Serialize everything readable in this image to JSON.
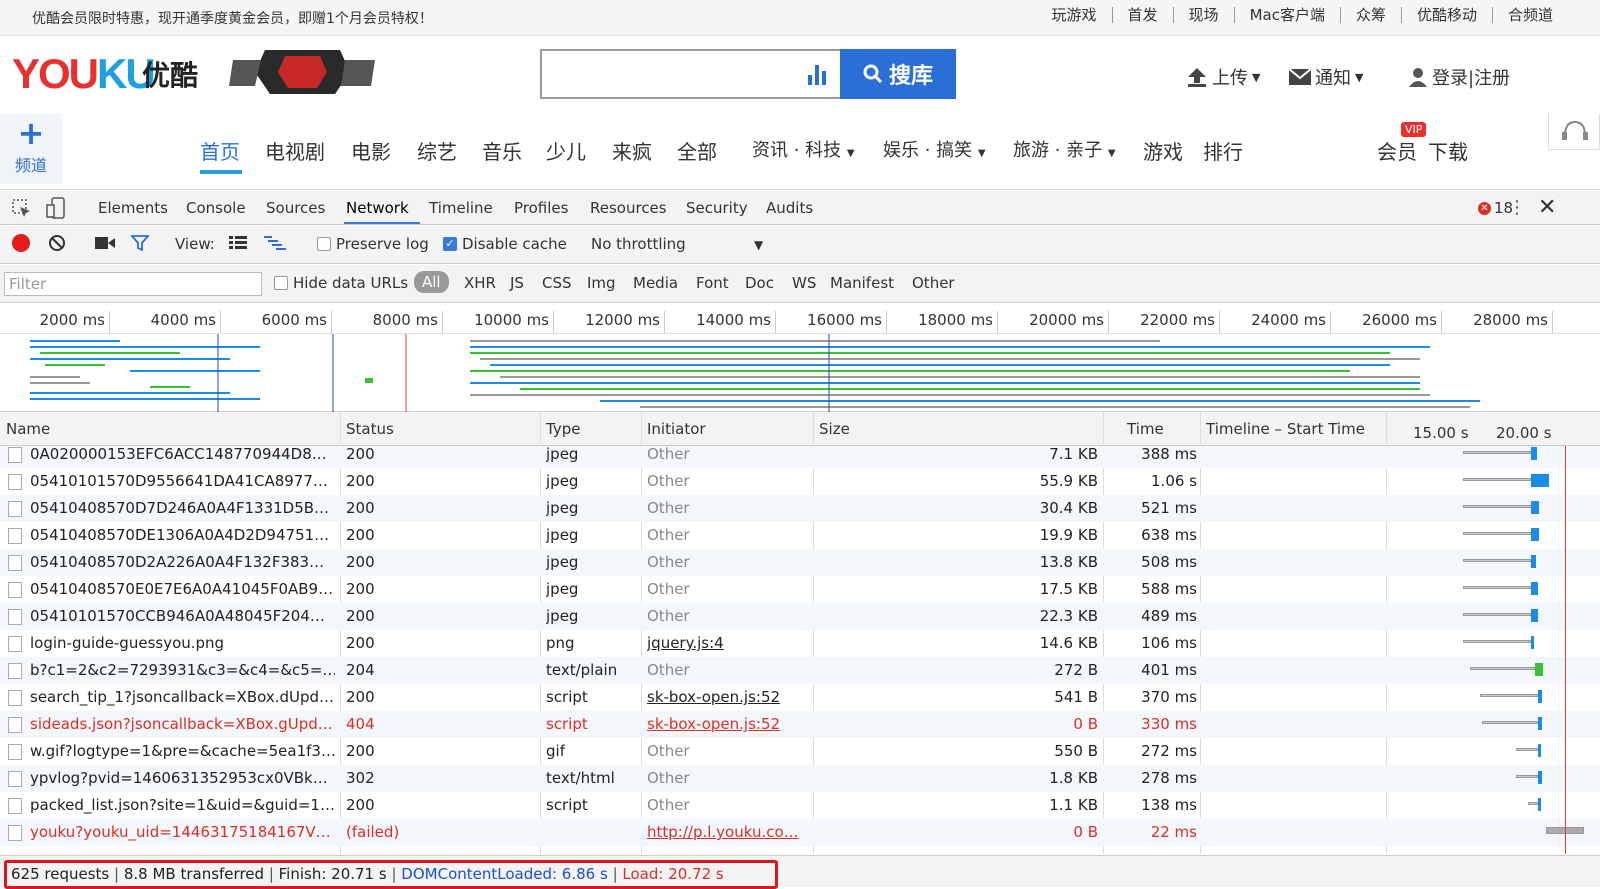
{
  "topbar": {
    "promo": "优酷会员限时特惠，现开通季度黄金会员，即赠1个月会员特权！",
    "links": [
      "玩游戏",
      "首发",
      "现场",
      "Mac客户端",
      "众筹",
      "优酷移动",
      "合频道"
    ]
  },
  "header": {
    "logo_a": "YOU",
    "logo_b": "KU",
    "logo_cn": "优酷",
    "search_button": "搜库",
    "upload": "上传",
    "notify": "通知",
    "login": "登录|注册"
  },
  "nav": {
    "channel_label": "频道",
    "items": [
      "首页",
      "电视剧",
      "电影",
      "综艺",
      "音乐",
      "少儿",
      "来疯",
      "全部",
      "资讯 · 科技",
      "娱乐 · 搞笑",
      "旅游 · 亲子",
      "游戏",
      "排行"
    ],
    "vip_badge": "VIP",
    "member": "会员",
    "download": "下载"
  },
  "devtools": {
    "tabs": [
      "Elements",
      "Console",
      "Sources",
      "Network",
      "Timeline",
      "Profiles",
      "Resources",
      "Security",
      "Audits"
    ],
    "active_tab": "Network",
    "error_count": "18",
    "toolbar": {
      "view_label": "View:",
      "preserve_log": "Preserve log",
      "disable_cache": "Disable cache",
      "throttling": "No throttling"
    },
    "filter": {
      "placeholder": "Filter",
      "hide_data_urls": "Hide data URLs",
      "types": [
        "All",
        "XHR",
        "JS",
        "CSS",
        "Img",
        "Media",
        "Font",
        "Doc",
        "WS",
        "Manifest",
        "Other"
      ]
    },
    "ruler_ticks": [
      "2000 ms",
      "4000 ms",
      "6000 ms",
      "8000 ms",
      "10000 ms",
      "12000 ms",
      "14000 ms",
      "16000 ms",
      "18000 ms",
      "20000 ms",
      "22000 ms",
      "24000 ms",
      "26000 ms",
      "28000 ms"
    ],
    "columns": {
      "name": "Name",
      "status": "Status",
      "type": "Type",
      "initiator": "Initiator",
      "size": "Size",
      "time": "Time",
      "timeline": "Timeline – Start Time",
      "t1": "15.00 s",
      "t2": "20.00 s"
    },
    "rows": [
      {
        "name": "0A020000153EFC6ACC148770944D8…",
        "status": "200",
        "type": "jpeg",
        "initiator": "Other",
        "size": "7.1 KB",
        "time": "388 ms"
      },
      {
        "name": "05410101570D9556641DA41CA8977…",
        "status": "200",
        "type": "jpeg",
        "initiator": "Other",
        "size": "55.9 KB",
        "time": "1.06 s"
      },
      {
        "name": "05410408570D7D246A0A4F1331D5B…",
        "status": "200",
        "type": "jpeg",
        "initiator": "Other",
        "size": "30.4 KB",
        "time": "521 ms"
      },
      {
        "name": "05410408570DE1306A0A4D2D94751…",
        "status": "200",
        "type": "jpeg",
        "initiator": "Other",
        "size": "19.9 KB",
        "time": "638 ms"
      },
      {
        "name": "05410408570D2A226A0A4F132F383…",
        "status": "200",
        "type": "jpeg",
        "initiator": "Other",
        "size": "13.8 KB",
        "time": "508 ms"
      },
      {
        "name": "05410408570E0E7E6A0A41045F0AB9…",
        "status": "200",
        "type": "jpeg",
        "initiator": "Other",
        "size": "17.5 KB",
        "time": "588 ms"
      },
      {
        "name": "05410101570CCB946A0A48045F204…",
        "status": "200",
        "type": "jpeg",
        "initiator": "Other",
        "size": "22.3 KB",
        "time": "489 ms"
      },
      {
        "name": "login-guide-guessyou.png",
        "status": "200",
        "type": "png",
        "initiator": "jquery.js:4",
        "size": "14.6 KB",
        "time": "106 ms"
      },
      {
        "name": "b?c1=2&c2=7293931&c3=&c4=&c5=…",
        "status": "204",
        "type": "text/plain",
        "initiator": "Other",
        "size": "272 B",
        "time": "401 ms"
      },
      {
        "name": "search_tip_1?jsoncallback=XBox.dUpd…",
        "status": "200",
        "type": "script",
        "initiator": "sk-box-open.js:52",
        "size": "541 B",
        "time": "370 ms"
      },
      {
        "name": "sideads.json?jsoncallback=XBox.gUpd…",
        "status": "404",
        "type": "script",
        "initiator": "sk-box-open.js:52",
        "size": "0 B",
        "time": "330 ms"
      },
      {
        "name": "w.gif?logtype=1&pre=&cache=5ea1f3…",
        "status": "200",
        "type": "gif",
        "initiator": "Other",
        "size": "550 B",
        "time": "272 ms"
      },
      {
        "name": "ypvlog?pvid=1460631352953cx0VBk…",
        "status": "302",
        "type": "text/html",
        "initiator": "Other",
        "size": "1.8 KB",
        "time": "278 ms"
      },
      {
        "name": "packed_list.json?site=1&uid=&guid=1…",
        "status": "200",
        "type": "script",
        "initiator": "Other",
        "size": "1.1 KB",
        "time": "138 ms"
      },
      {
        "name": "youku?youku_uid=14463175184167V…",
        "status": "(failed)",
        "type": "",
        "initiator": "http://p.l.youku.co…",
        "size": "0 B",
        "time": "22 ms"
      }
    ],
    "summary": {
      "requests": "625 requests",
      "transferred": "8.8 MB transferred",
      "finish": "Finish: 20.71 s",
      "dcl": "DOMContentLoaded: 6.86 s",
      "load": "Load: 20.72 s"
    }
  }
}
